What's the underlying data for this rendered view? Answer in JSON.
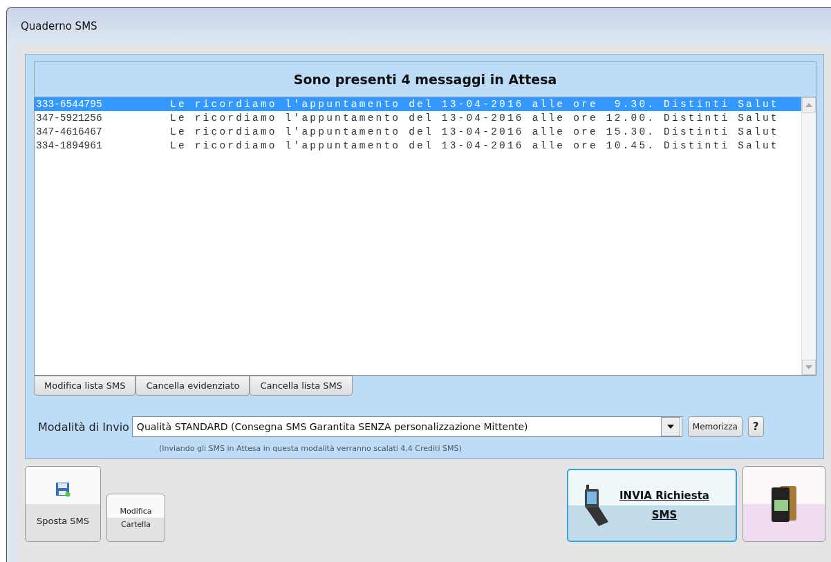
{
  "window": {
    "title": "Quaderno SMS"
  },
  "list": {
    "header": "Sono presenti 4 messaggi in Attesa",
    "rows": [
      {
        "phone": "333-6544795",
        "message": "Le ricordiamo l'appuntamento del 13-04-2016 alle ore  9.30. Distinti Salut",
        "selected": true
      },
      {
        "phone": "347-5921256",
        "message": "Le ricordiamo l'appuntamento del 13-04-2016 alle ore 12.00. Distinti Salut",
        "selected": false
      },
      {
        "phone": "347-4616467",
        "message": "Le ricordiamo l'appuntamento del 13-04-2016 alle ore 15.30. Distinti Salut",
        "selected": false
      },
      {
        "phone": "334-1894961",
        "message": "Le ricordiamo l'appuntamento del 13-04-2016 alle ore 10.45. Distinti Salut",
        "selected": false
      }
    ]
  },
  "list_buttons": [
    "Modifica lista SMS",
    "Cancella evidenziato",
    "Cancella lista SMS"
  ],
  "mode": {
    "label": "Modalità di Invio",
    "value": "Qualità STANDARD (Consegna SMS Garantita SENZA personalizzazione Mittente)",
    "save_button": "Memorizza",
    "help_button": "?",
    "note": "(Inviando gli SMS in Attesa in questa modalità verranno scalati 4,4 Crediti SMS)"
  },
  "bottom_buttons": {
    "move": "Sposta SMS",
    "folder": [
      "Modifica",
      "Cartella"
    ],
    "send": [
      "INVIA Richiesta",
      "SMS"
    ]
  }
}
